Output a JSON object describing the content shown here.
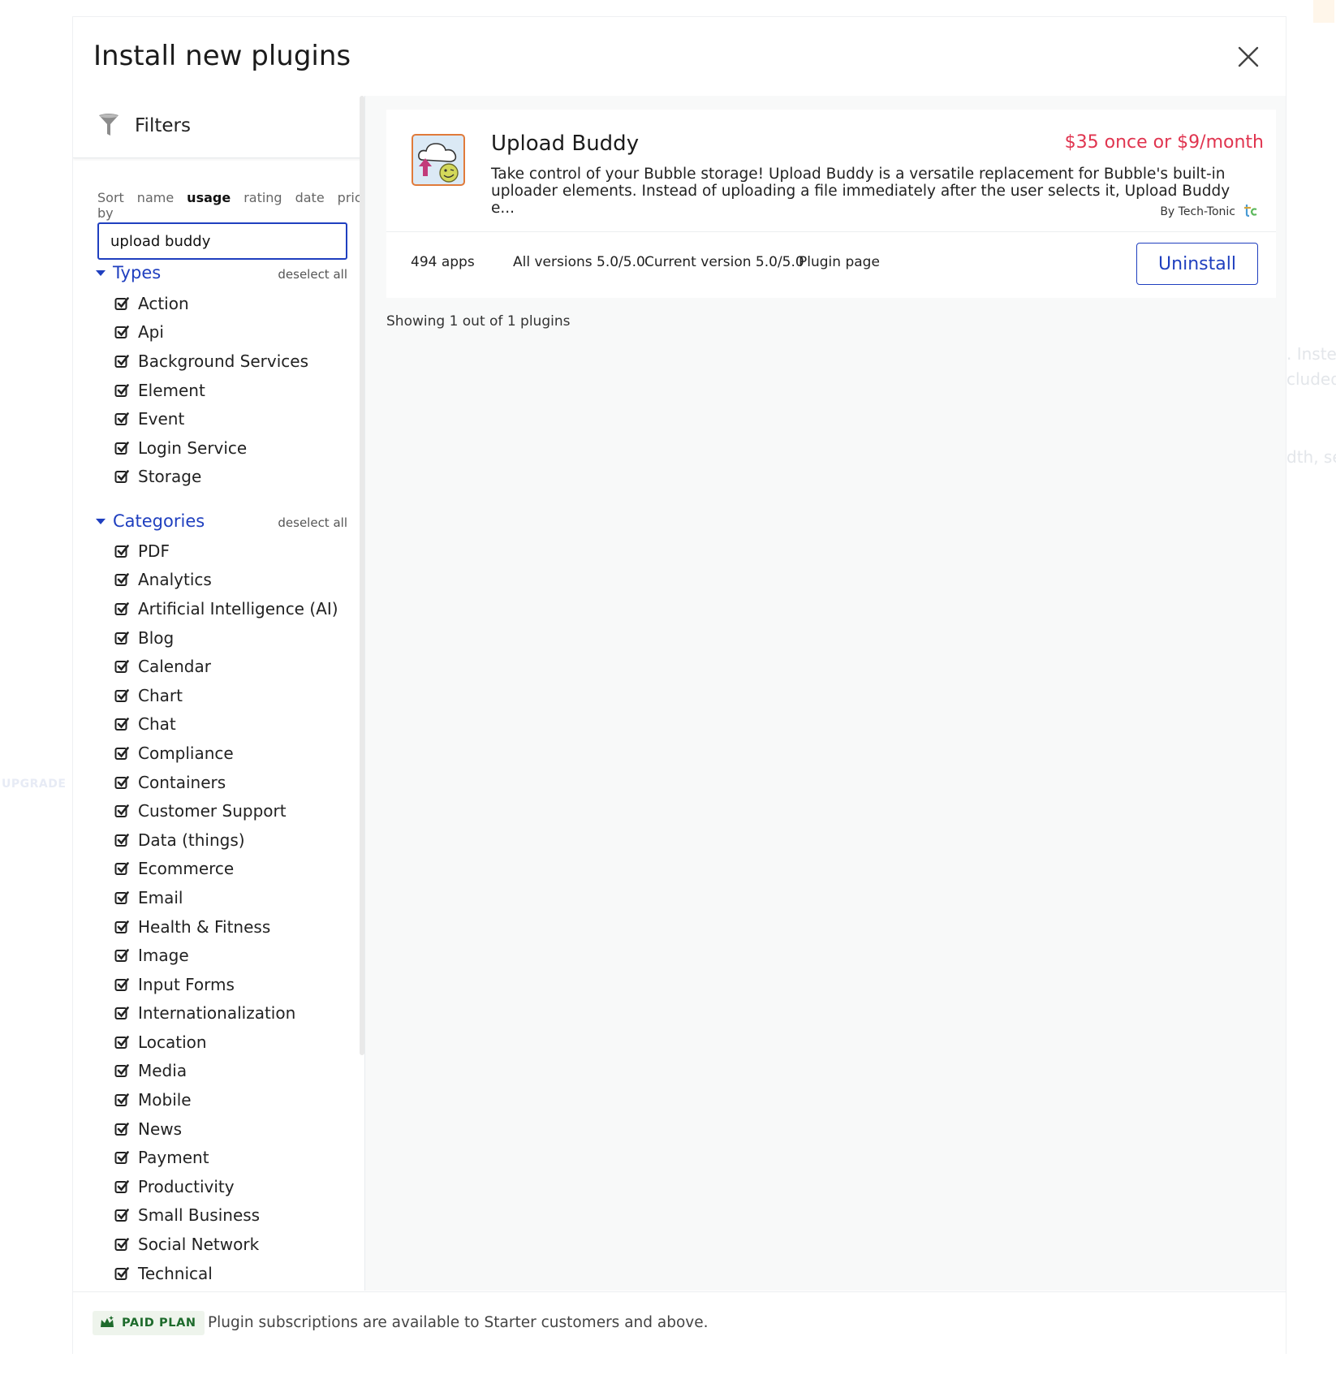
{
  "modal": {
    "title": "Install new plugins"
  },
  "filters": {
    "label": "Filters",
    "sort_by": "Sort by",
    "sort_options": [
      "name",
      "usage",
      "rating",
      "date",
      "price"
    ],
    "search_value": "upload buddy"
  },
  "types": {
    "label": "Types",
    "deselect": "deselect all",
    "items": [
      "Action",
      "Api",
      "Background Services",
      "Element",
      "Event",
      "Login Service",
      "Storage"
    ]
  },
  "categories": {
    "label": "Categories",
    "deselect": "deselect all",
    "items": [
      "PDF",
      "Analytics",
      "Artificial Intelligence (AI)",
      "Blog",
      "Calendar",
      "Chart",
      "Chat",
      "Compliance",
      "Containers",
      "Customer Support",
      "Data (things)",
      "Ecommerce",
      "Email",
      "Health & Fitness",
      "Image",
      "Input Forms",
      "Internationalization",
      "Location",
      "Media",
      "Mobile",
      "News",
      "Payment",
      "Productivity",
      "Small Business",
      "Social Network",
      "Technical"
    ]
  },
  "plugin": {
    "name": "Upload Buddy",
    "price": "$35 once or $9/month",
    "description": "Take control of your Bubble storage! Upload Buddy is a versatile replacement for Bubble's built-in uploader elements. Instead of uploading a file immediately after the user selects it, Upload Buddy e...",
    "author": "By Tech-Tonic",
    "apps": "494 apps",
    "all_versions": "All versions 5.0/5.0",
    "current_version": "Current version 5.0/5.0",
    "plugin_page": "Plugin page",
    "action": "Uninstall"
  },
  "results": {
    "showing": "Showing 1 out of 1 plugins"
  },
  "footer": {
    "badge": "PAID PLAN",
    "text": "Plugin subscriptions are available to Starter customers and above."
  },
  "background": {
    "upgrade": "UPGRADE",
    "frag1": ". Inste",
    "frag2": "cluded",
    "frag3": "dth, se"
  },
  "colors": {
    "accent": "#1f3fbf",
    "price": "#e0344f",
    "paid_green": "#1e6b2c"
  }
}
